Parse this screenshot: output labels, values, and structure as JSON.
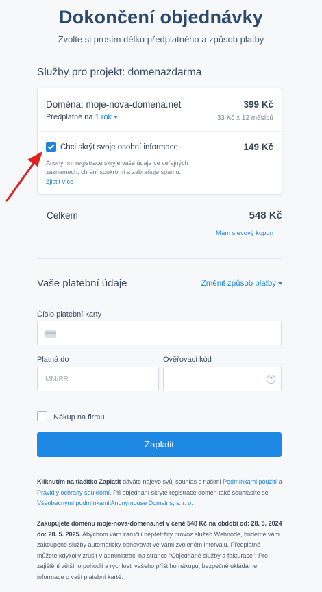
{
  "header": {
    "title": "Dokončení objednávky",
    "subtitle": "Zvolte si prosím délku předplatného a způsob platby"
  },
  "services": {
    "label": "Služby pro projekt: domenazdarma",
    "domain_line": "Doména: moje-nova-domena.net",
    "domain_price": "399 Kč",
    "subscription_prefix": "Předplatné na",
    "subscription_value": "1 rok",
    "price_breakdown": "33 Kč x 12 měsíců",
    "privacy": {
      "checked": true,
      "label": "Chci skrýt svoje osobní informace",
      "price": "149 Kč",
      "description": "Anonymní registrace skryje vaše údaje ve veřejných záznamech, chrání soukromí a zabraňuje spamu.",
      "learn_more": "Zjistit více"
    }
  },
  "total": {
    "label": "Celkem",
    "value": "548 Kč",
    "coupon": "Mám slevový kupon"
  },
  "payment": {
    "title": "Vaše platební údaje",
    "change_method": "Změnit způsob platby",
    "card_number_label": "Číslo platební karty",
    "valid_to_label": "Platná do",
    "valid_to_placeholder": "MM/RR",
    "cvc_label": "Ověřovací kód",
    "company_label": "Nákup na firmu",
    "pay_button": "Zaplatit"
  },
  "legal": {
    "p1_bold": "Kliknutím na tlačítko Zaplatit",
    "p1_text1": " dáváte najevo svůj souhlas s našimi ",
    "p1_link1": "Podmínkami použití",
    "p1_text2": " a ",
    "p1_link2": "Pravidly ochrany soukromí",
    "p1_text3": ". Při objednání skryté registrace domén také souhlasíte se ",
    "p1_link3": "Všeobecnými podmínkami Anonymouse Domains, s. r. o.",
    "p2_bold": "Zakupujete doménu moje-nova-domena.net v ceně 548 Kč na období od: 28. 5. 2024 do: 28. 5. 2025.",
    "p2_text": " Abychom vám zaručili nepřetržitý provoz služeb Webnode, budeme vám zakoupené služby automaticky obnovovat ve vámi zvoleném intervalu. Předplatné můžete kdykoliv zrušit v administraci na stránce \"Objednané služby a fakturace\". Pro zajištění většího pohodlí a rychlosti vašeho příštího nákupu, bezpečně ukládáme informace o vaší platební kartě."
  },
  "colors": {
    "accent": "#1e88e5",
    "title": "#2c4a6e",
    "annotation_arrow": "#e02020"
  },
  "icons": {
    "privacy_checkbox": "checkbox-checked-icon",
    "card": "credit-card-icon",
    "help": "question-circle-icon",
    "dropdown": "chevron-down-icon",
    "annotation": "red-arrow-icon"
  }
}
